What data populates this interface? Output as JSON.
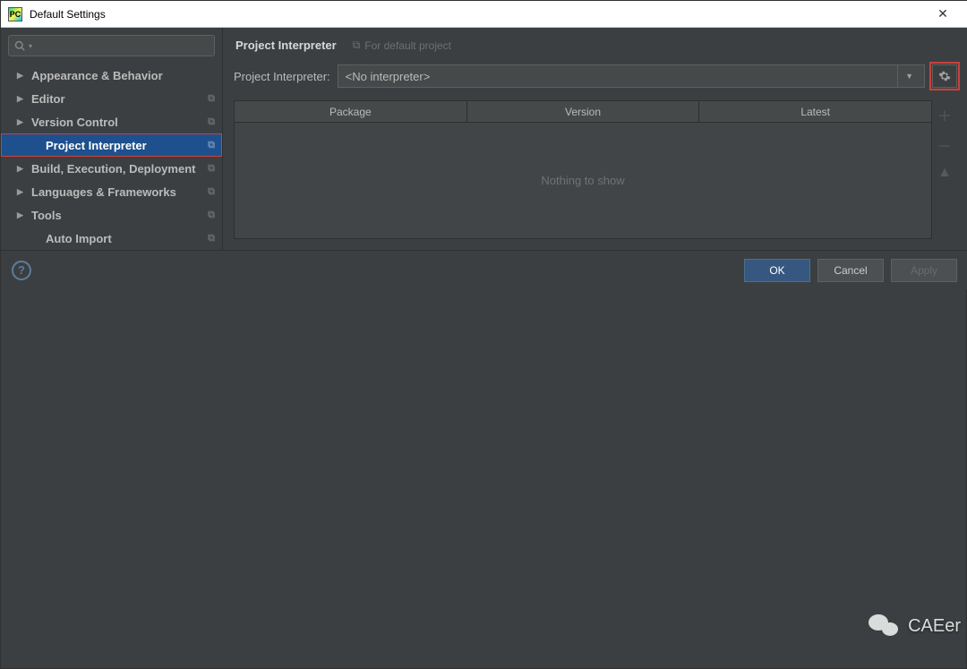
{
  "window": {
    "title": "Default Settings"
  },
  "search": {
    "placeholder": ""
  },
  "sidebar": {
    "items": [
      {
        "label": "Appearance & Behavior",
        "hasArrow": true,
        "copy": false
      },
      {
        "label": "Editor",
        "hasArrow": true,
        "copy": true
      },
      {
        "label": "Version Control",
        "hasArrow": true,
        "copy": true
      },
      {
        "label": "Project Interpreter",
        "hasArrow": false,
        "copy": true,
        "selected": true,
        "child": true
      },
      {
        "label": "Build, Execution, Deployment",
        "hasArrow": true,
        "copy": true
      },
      {
        "label": "Languages & Frameworks",
        "hasArrow": true,
        "copy": true
      },
      {
        "label": "Tools",
        "hasArrow": true,
        "copy": true
      },
      {
        "label": "Auto Import",
        "hasArrow": false,
        "copy": true,
        "child": true
      }
    ]
  },
  "breadcrumb": {
    "current": "Project Interpreter",
    "hint": "For default project"
  },
  "interpreter": {
    "label": "Project Interpreter:",
    "value": "<No interpreter>"
  },
  "table": {
    "columns": [
      "Package",
      "Version",
      "Latest"
    ],
    "empty": "Nothing to show"
  },
  "footer": {
    "ok": "OK",
    "cancel": "Cancel",
    "apply": "Apply"
  },
  "watermark": "CAEer"
}
